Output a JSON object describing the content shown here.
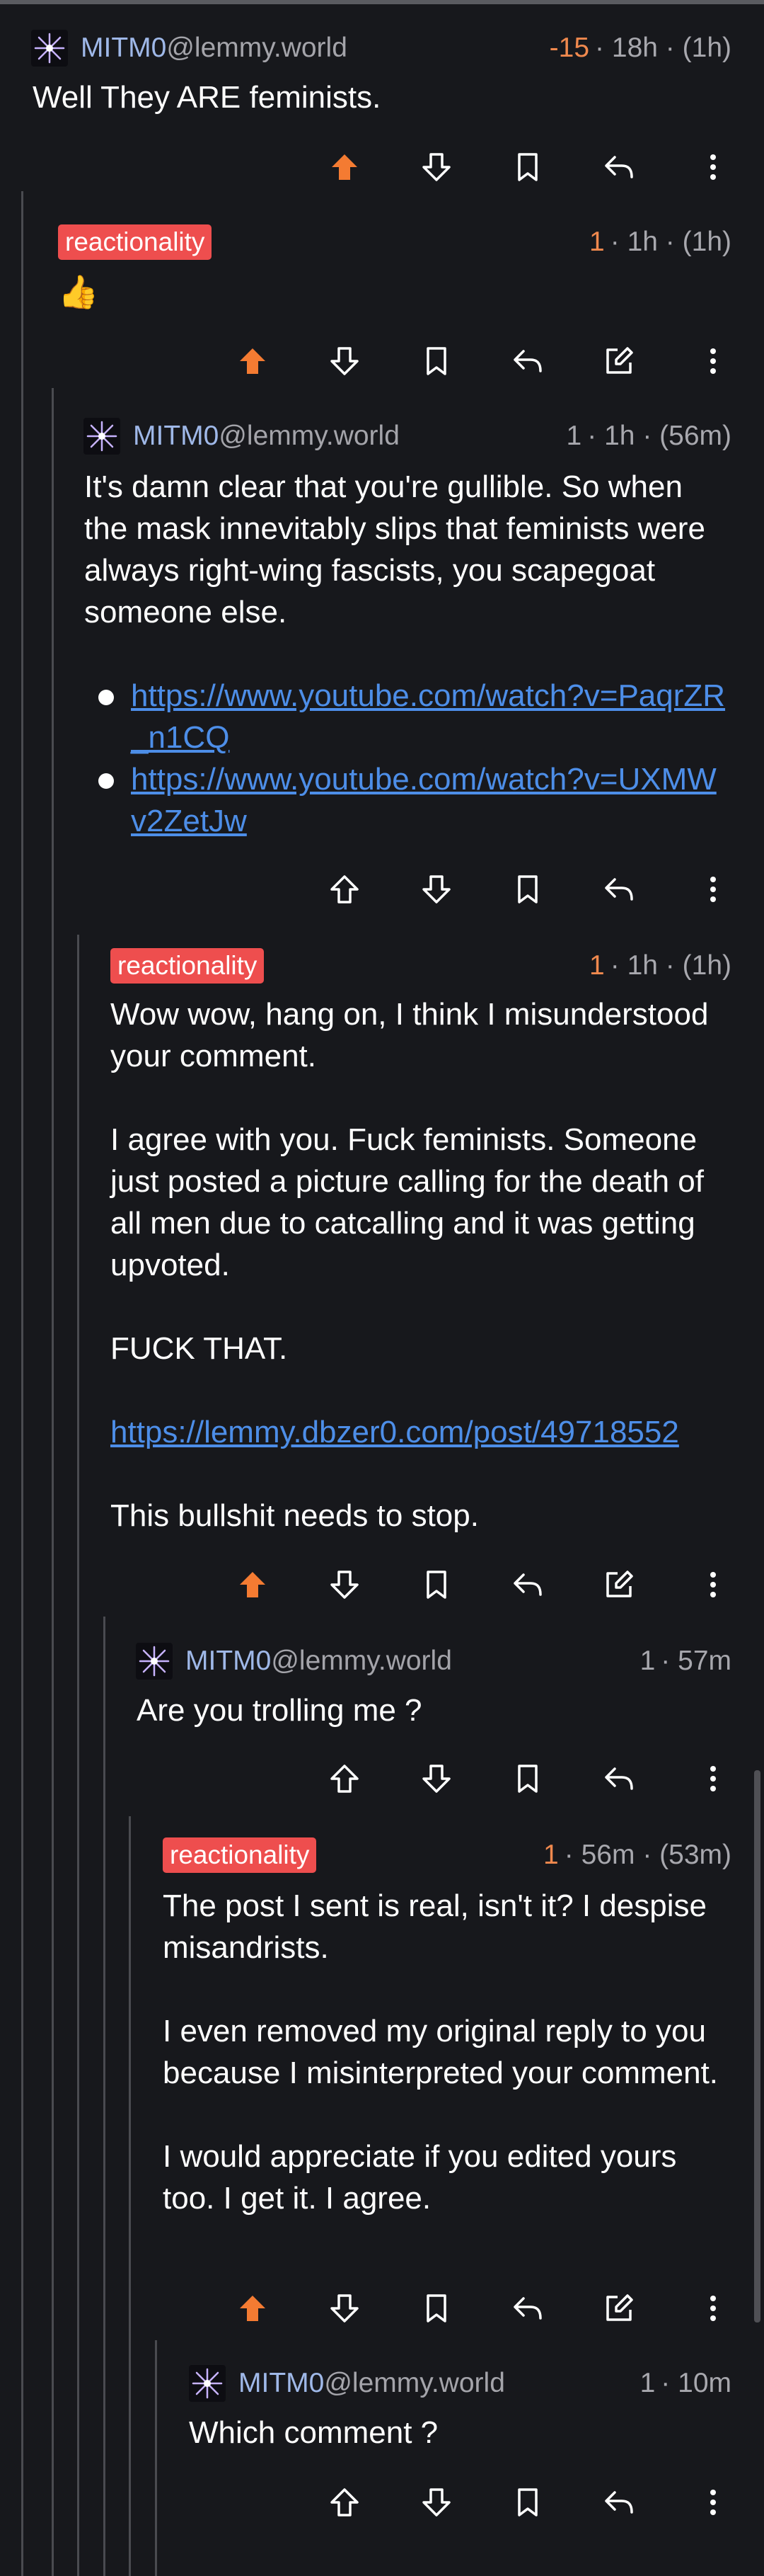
{
  "comments": [
    {
      "author": "MITM0",
      "instance": "@lemmy.world",
      "score": "-15",
      "time": "18h",
      "edited": "(1h)",
      "body": [
        "Well They ARE feminists."
      ]
    },
    {
      "badge": "reactionality",
      "score": "1",
      "time": "1h",
      "edited": "(1h)",
      "emoji": "👍"
    },
    {
      "author": "MITM0",
      "instance": "@lemmy.world",
      "score": "1",
      "time": "1h",
      "edited": "(56m)",
      "body": [
        "It's damn clear that you're gullible. So when the mask innevitably slips that feminists were always right-wing fascists, you scapegoat someone else."
      ],
      "links": [
        "https://www.youtube.com/watch?v=PaqrZR_n1CQ",
        "https://www.youtube.com/watch?v=UXMWv2ZetJw"
      ]
    },
    {
      "badge": "reactionality",
      "score": "1",
      "time": "1h",
      "edited": "(1h)",
      "body": [
        "Wow wow, hang on, I think I misunderstood your comment.",
        "I agree with you. Fuck feminists. Someone just posted a picture calling for the death of all men due to catcalling and it was getting upvoted.",
        "FUCK THAT.",
        "https://lemmy.dbzer0.com/post/49718552",
        "This bullshit needs to stop."
      ]
    },
    {
      "author": "MITM0",
      "instance": "@lemmy.world",
      "score": "1",
      "time": "57m",
      "body": [
        "Are you trolling me ?"
      ]
    },
    {
      "badge": "reactionality",
      "score": "1",
      "time": "56m",
      "edited": "(53m)",
      "body": [
        "The post I sent is real, isn't it? I despise misandrists.",
        "I even removed my original reply to you because I misinterpreted your comment.",
        "I would appreciate if you edited yours too. I get it. I agree."
      ]
    },
    {
      "author": "MITM0",
      "instance": "@lemmy.world",
      "score": "1",
      "time": "10m",
      "body": [
        "Which comment ?"
      ]
    }
  ],
  "separator": "·",
  "icons": {
    "upvote": "arrow-up-icon",
    "downvote": "arrow-down-icon",
    "save": "bookmark-icon",
    "reply": "reply-icon",
    "edit": "edit-icon",
    "more": "more-vertical-icon"
  },
  "colors": {
    "background": "#17181c",
    "upvoted": "#f47b32",
    "score": "#f0894e",
    "badge": "#ee4e4e",
    "link": "#4d8ee8",
    "author": "#9fb8e8"
  }
}
